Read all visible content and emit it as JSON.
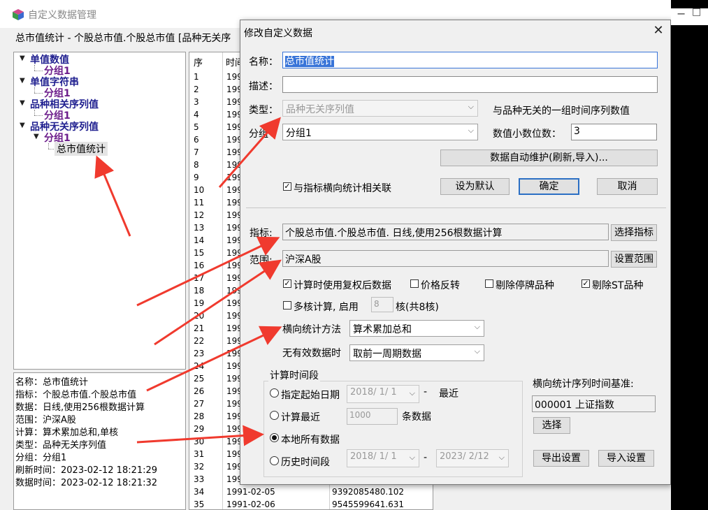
{
  "main": {
    "title": "自定义数据管理",
    "subheader": "总市值统计 - 个股总市值.个股总市值 [品种无关序"
  },
  "tree": {
    "n1": "单值数值",
    "n1g": "分组1",
    "n2": "单值字符串",
    "n2g": "分组1",
    "n3": "品种相关序列值",
    "n3g": "分组1",
    "n4": "品种无关序列值",
    "n4g": "分组1",
    "leaf": "总市值统计"
  },
  "info": {
    "l1": "名称：总市值统计",
    "l2": "指标：个股总市值.个股总市值",
    "l3": "数据：日线,使用256根数据计算",
    "l4": "范围：沪深A股",
    "l5": "计算：算术累加总和,单核",
    "l6": "类型：品种无关序列值",
    "l7": "分组：分组1",
    "l8": "刷新时间：2023-02-12 18:21:29",
    "l9": "数据时间：2023-02-12 18:21:32"
  },
  "table": {
    "col_seq": "序",
    "col_time": "时间",
    "rows": [
      {
        "seq": "1",
        "time": "199"
      },
      {
        "seq": "2",
        "time": "199"
      },
      {
        "seq": "3",
        "time": "199"
      },
      {
        "seq": "4",
        "time": "199"
      },
      {
        "seq": "5",
        "time": "199"
      },
      {
        "seq": "6",
        "time": "199"
      },
      {
        "seq": "7",
        "time": "199"
      },
      {
        "seq": "8",
        "time": "199"
      },
      {
        "seq": "9",
        "time": "199"
      },
      {
        "seq": "10",
        "time": "199"
      },
      {
        "seq": "11",
        "time": "199"
      },
      {
        "seq": "12",
        "time": "199"
      },
      {
        "seq": "13",
        "time": "199"
      },
      {
        "seq": "14",
        "time": "199"
      },
      {
        "seq": "15",
        "time": "199"
      },
      {
        "seq": "16",
        "time": "199"
      },
      {
        "seq": "17",
        "time": "199"
      },
      {
        "seq": "18",
        "time": "199"
      },
      {
        "seq": "19",
        "time": "199"
      },
      {
        "seq": "20",
        "time": "199"
      },
      {
        "seq": "21",
        "time": "199"
      },
      {
        "seq": "22",
        "time": "199"
      },
      {
        "seq": "23",
        "time": "199"
      },
      {
        "seq": "24",
        "time": "199"
      },
      {
        "seq": "25",
        "time": "199"
      },
      {
        "seq": "26",
        "time": "199"
      },
      {
        "seq": "27",
        "time": "199"
      },
      {
        "seq": "28",
        "time": "199"
      },
      {
        "seq": "29",
        "time": "199"
      },
      {
        "seq": "30",
        "time": "199"
      },
      {
        "seq": "31",
        "time": "199"
      },
      {
        "seq": "32",
        "time": "199"
      },
      {
        "seq": "33",
        "time": "199"
      },
      {
        "seq": "34",
        "time": "1991-02-05",
        "value": "9392085480.102"
      },
      {
        "seq": "35",
        "time": "1991-02-06",
        "value": "9545599641.631"
      }
    ]
  },
  "dialog": {
    "title": "修改自定义数据",
    "name_label": "名称：",
    "name_value": "总市值统计",
    "desc_label": "描述：",
    "desc_value": "",
    "type_label": "类型：",
    "type_value": "品种无关序列值",
    "type_desc": "与品种无关的一组时间序列数值",
    "group_label": "分组",
    "group_value": "分组1",
    "decimals_label": "数值小数位数：",
    "decimals_value": "3",
    "auto_maint_btn": "数据自动维护(刷新,导入)...",
    "link_label": "与指标横向统计相关联",
    "set_default_btn": "设为默认",
    "ok_btn": "确定",
    "cancel_btn": "取消",
    "indicator_label": "指标:",
    "indicator_value": "个股总市值.个股总市值. 日线,使用256根数据计算",
    "select_indicator_btn": "选择指标",
    "range_label": "范围:",
    "range_value": "沪深A股",
    "set_range_btn": "设置范围",
    "opt_adjusted": "计算时使用复权后数据",
    "opt_price_reverse": "价格反转",
    "opt_exclude_suspended": "剔除停牌品种",
    "opt_exclude_st": "剔除ST品种",
    "multicore_label": "多核计算, 启用",
    "cores_value": "8",
    "cores_suffix": "核(共8核)",
    "method_label": "横向统计方法",
    "method_value": "算术累加总和",
    "invalid_label": "无有效数据时",
    "invalid_value": "取前一周期数据",
    "period_group_label": "计算时间段",
    "r1_label": "指定起始日期",
    "r1_date": "2018/ 1/ 1",
    "r1_suffix": "最近",
    "r2_label": "计算最近",
    "r2_value": "1000",
    "r2_suffix": "条数据",
    "r3_label": "本地所有数据",
    "r4_label": "历史时间段",
    "r4_from": "2018/ 1/ 1",
    "r4_to": "2023/ 2/12",
    "dash": "-",
    "baseline_label": "横向统计序列时间基准:",
    "baseline_value": "000001 上证指数",
    "select_btn": "选择",
    "export_btn": "导出设置",
    "import_btn": "导入设置"
  },
  "colors": {
    "tree_node": "#1f1f8f",
    "tree_group": "#6b1c8a",
    "annotation_arrow": "#f03a2e",
    "selection": "#3874d8",
    "default_button_border": "#2b6fc4"
  }
}
